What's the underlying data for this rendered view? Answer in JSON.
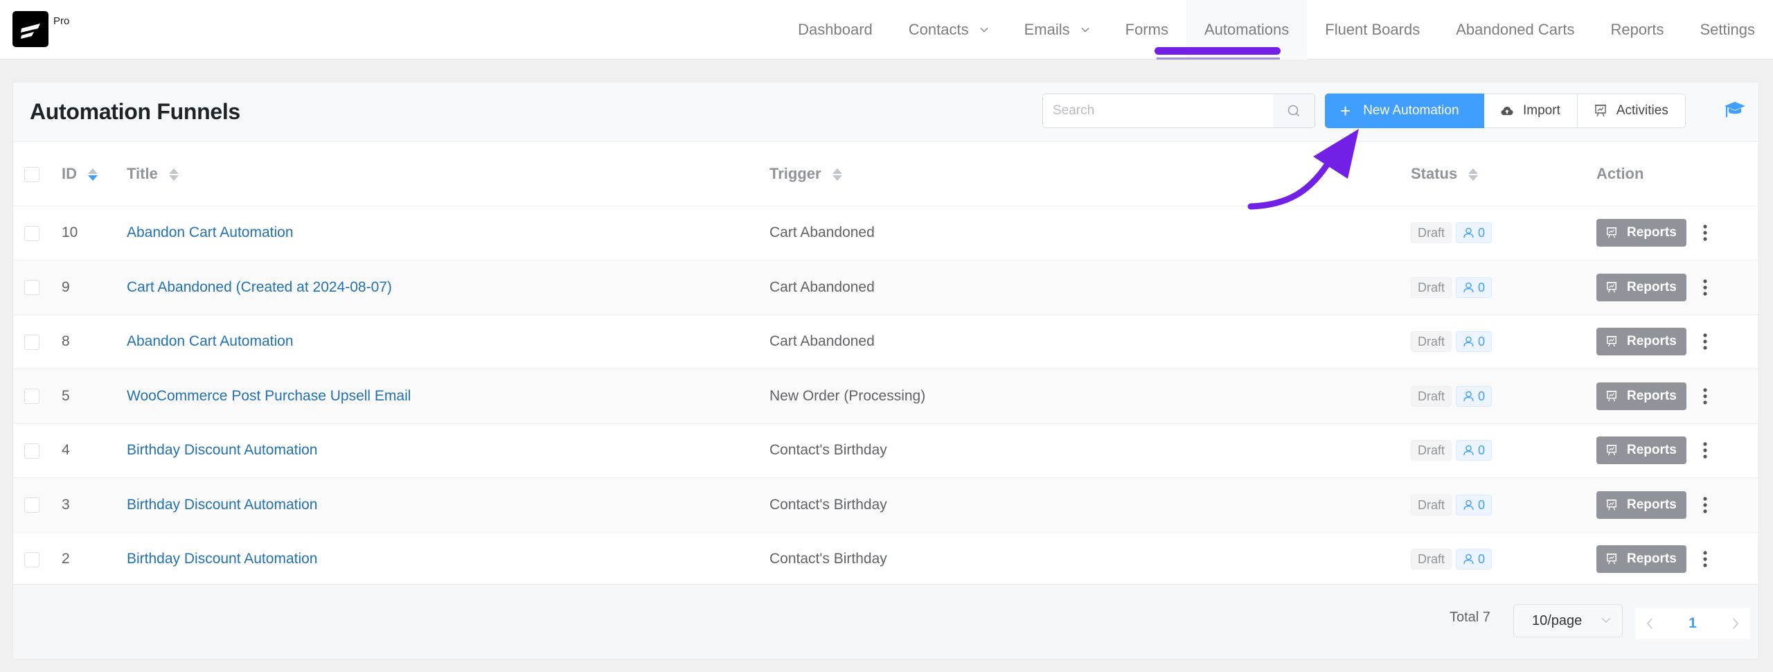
{
  "brand": {
    "badge": "Pro",
    "logo_icon": "fluentcrm-logo-icon"
  },
  "nav": {
    "items": [
      {
        "label": "Dashboard",
        "dropdown": false,
        "active": false
      },
      {
        "label": "Contacts",
        "dropdown": true,
        "active": false
      },
      {
        "label": "Emails",
        "dropdown": true,
        "active": false
      },
      {
        "label": "Forms",
        "dropdown": false,
        "active": false
      },
      {
        "label": "Automations",
        "dropdown": false,
        "active": true
      },
      {
        "label": "Fluent Boards",
        "dropdown": false,
        "active": false
      },
      {
        "label": "Abandoned Carts",
        "dropdown": false,
        "active": false
      },
      {
        "label": "Reports",
        "dropdown": false,
        "active": false
      },
      {
        "label": "Settings",
        "dropdown": false,
        "active": false
      }
    ]
  },
  "page": {
    "title": "Automation Funnels",
    "search": {
      "placeholder": "Search",
      "value": ""
    },
    "toolbar": {
      "new_label": "New Automation",
      "import_label": "Import",
      "activities_label": "Activities"
    }
  },
  "table": {
    "columns": {
      "id": "ID",
      "title": "Title",
      "trigger": "Trigger",
      "status": "Status",
      "action": "Action"
    },
    "sort": {
      "column": "ID",
      "direction": "desc"
    },
    "rows": [
      {
        "id": "10",
        "title": "Abandon Cart Automation",
        "trigger": "Cart Abandoned",
        "status": "Draft",
        "subscribers": "0",
        "action": "Reports"
      },
      {
        "id": "9",
        "title": "Cart Abandoned (Created at 2024-08-07)",
        "trigger": "Cart Abandoned",
        "status": "Draft",
        "subscribers": "0",
        "action": "Reports"
      },
      {
        "id": "8",
        "title": "Abandon Cart Automation",
        "trigger": "Cart Abandoned",
        "status": "Draft",
        "subscribers": "0",
        "action": "Reports"
      },
      {
        "id": "5",
        "title": "WooCommerce Post Purchase Upsell Email",
        "trigger": "New Order (Processing)",
        "status": "Draft",
        "subscribers": "0",
        "action": "Reports"
      },
      {
        "id": "4",
        "title": "Birthday Discount Automation",
        "trigger": "Contact's Birthday",
        "status": "Draft",
        "subscribers": "0",
        "action": "Reports"
      },
      {
        "id": "3",
        "title": "Birthday Discount Automation",
        "trigger": "Contact's Birthday",
        "status": "Draft",
        "subscribers": "0",
        "action": "Reports"
      },
      {
        "id": "2",
        "title": "Birthday Discount Automation",
        "trigger": "Contact's Birthday",
        "status": "Draft",
        "subscribers": "0",
        "action": "Reports"
      }
    ]
  },
  "pagination": {
    "total_label": "Total 7",
    "per_page": "10/page",
    "current_page": "1"
  },
  "colors": {
    "primary": "#409eff",
    "link": "#2271b1",
    "annotation": "#7220e6",
    "reports_button": "#909399"
  }
}
